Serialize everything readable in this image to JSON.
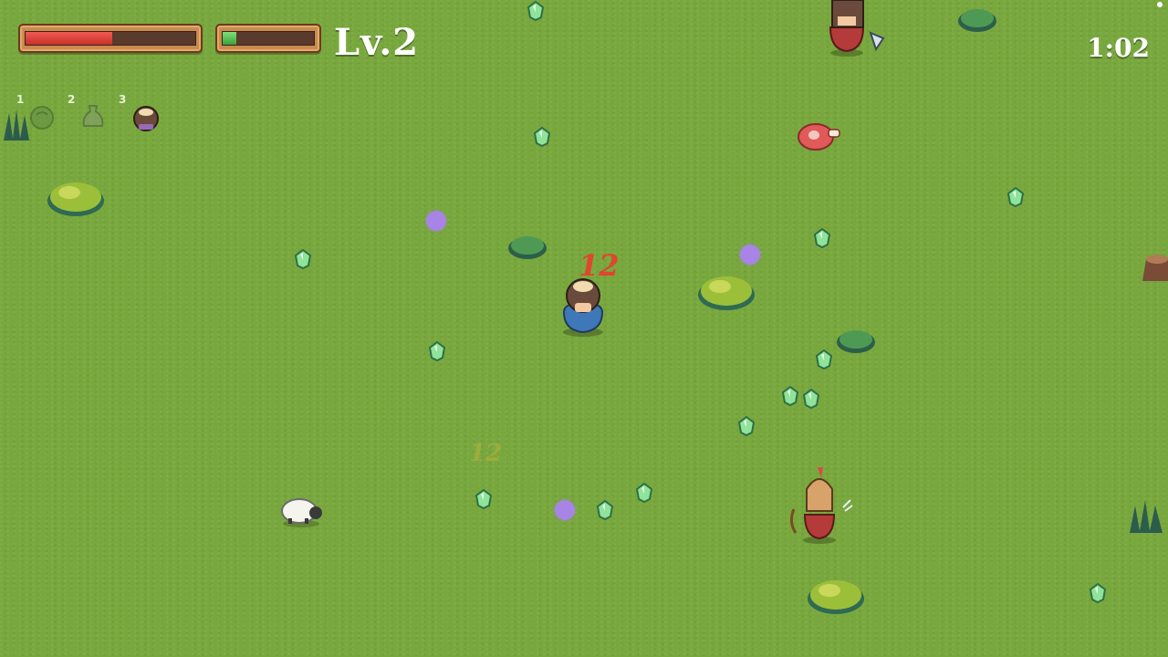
{
  "hud": {
    "health_fraction": 0.51,
    "xp_fraction": 0.15,
    "level_label": "Lv.2",
    "timer": "1:02",
    "colors": {
      "health": "#d73a33",
      "xp": "#4cc24a",
      "frame": "#c98b4f"
    }
  },
  "weapon_slots": [
    {
      "number": "1",
      "icon": "cabbage-icon",
      "unlocked": false
    },
    {
      "number": "2",
      "icon": "potion-bag-icon",
      "unlocked": false
    },
    {
      "number": "3",
      "icon": "player-head-icon",
      "unlocked": true
    }
  ],
  "damage_numbers": [
    {
      "value": "12",
      "color": "#e0452e"
    },
    {
      "value": "12",
      "color": "#c8b43a"
    }
  ],
  "colors": {
    "grass": "#78a83d",
    "gem": "#8fe39a",
    "orb": "#a884e6"
  }
}
